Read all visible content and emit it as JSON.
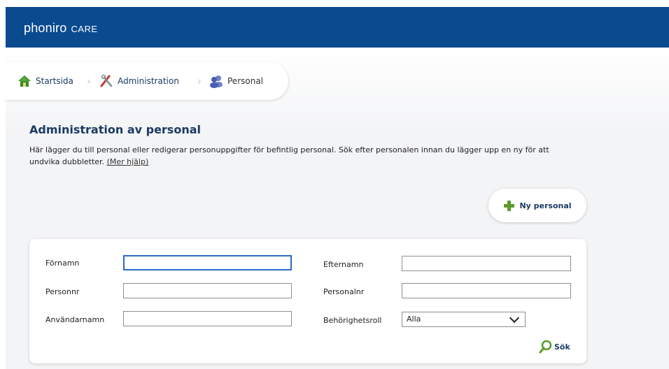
{
  "app": {
    "brand": "phoniro",
    "brand_suffix": "CARE"
  },
  "breadcrumb": {
    "items": [
      {
        "label": "Startsida",
        "icon": "home-icon"
      },
      {
        "label": "Administration",
        "icon": "tools-icon"
      },
      {
        "label": "Personal",
        "icon": "people-icon"
      }
    ],
    "separator": "›"
  },
  "page": {
    "title": "Administration av personal",
    "description": "Här lägger du till personal eller redigerar personuppgifter för befintlig personal. Sök efter personalen innan du lägger upp en ny för att undvika dubbletter.",
    "help_link": "(Mer hjälp)"
  },
  "actions": {
    "new_staff_label": "Ny personal",
    "new_staff_icon": "plus-icon"
  },
  "search_form": {
    "fields": {
      "first_name": {
        "label": "Förnamn",
        "value": ""
      },
      "last_name": {
        "label": "Efternamn",
        "value": ""
      },
      "personal_id_number": {
        "label": "Personnr",
        "value": ""
      },
      "staff_number": {
        "label": "Personalnr",
        "value": ""
      },
      "username": {
        "label": "Användarnamn",
        "value": ""
      },
      "role": {
        "label": "Behörighetsroll",
        "selected": "Alla"
      }
    },
    "submit_label": "Sök",
    "submit_icon": "search-icon"
  },
  "colors": {
    "header": "#0a4a8f",
    "accent_green": "#5a9a2a",
    "title": "#1b3a64"
  }
}
